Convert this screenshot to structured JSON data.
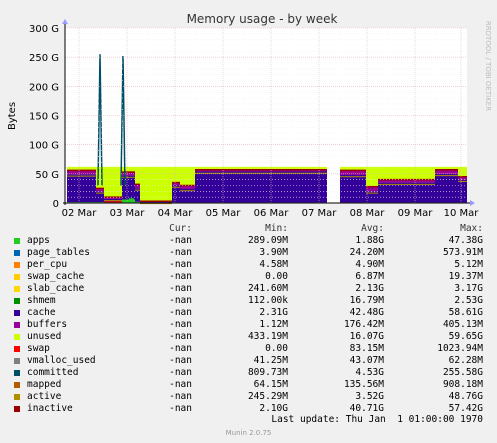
{
  "chart_data": {
    "type": "area",
    "title": "Memory usage - by week",
    "ylabel": "Bytes",
    "watermark": "RRDTOOL / TOBI OETIKER",
    "y_ticks": [
      "0",
      "50 G",
      "100 G",
      "150 G",
      "200 G",
      "250 G",
      "300 G"
    ],
    "ylim_G": [
      0,
      300
    ],
    "x_ticks": [
      "02 Mar",
      "03 Mar",
      "04 Mar",
      "05 Mar",
      "06 Mar",
      "07 Mar",
      "08 Mar",
      "09 Mar",
      "10 Mar"
    ],
    "grid": true,
    "legend_headers": {
      "cur": "Cur:",
      "min": "Min:",
      "avg": "Avg:",
      "max": "Max:"
    },
    "series": [
      {
        "name": "apps",
        "color": "#22cc22",
        "cur": "-nan",
        "min": "289.09M",
        "avg": "1.88G",
        "max": "47.38G"
      },
      {
        "name": "page_tables",
        "color": "#0066b3",
        "cur": "-nan",
        "min": "3.90M",
        "avg": "24.20M",
        "max": "573.91M"
      },
      {
        "name": "per_cpu",
        "color": "#ff8000",
        "cur": "-nan",
        "min": "4.58M",
        "avg": "4.90M",
        "max": "5.12M"
      },
      {
        "name": "swap_cache",
        "color": "#ffcc00",
        "cur": "-nan",
        "min": "0.00",
        "avg": "6.87M",
        "max": "19.37M"
      },
      {
        "name": "slab_cache",
        "color": "#ffd700",
        "cur": "-nan",
        "min": "241.60M",
        "avg": "2.13G",
        "max": "3.17G"
      },
      {
        "name": "shmem",
        "color": "#008f00",
        "cur": "-nan",
        "min": "112.00k",
        "avg": "16.79M",
        "max": "2.53G"
      },
      {
        "name": "cache",
        "color": "#330099",
        "cur": "-nan",
        "min": "2.31G",
        "avg": "42.48G",
        "max": "58.61G"
      },
      {
        "name": "buffers",
        "color": "#990099",
        "cur": "-nan",
        "min": "1.12M",
        "avg": "176.42M",
        "max": "405.13M"
      },
      {
        "name": "unused",
        "color": "#ccff00",
        "cur": "-nan",
        "min": "433.19M",
        "avg": "16.07G",
        "max": "59.65G"
      },
      {
        "name": "swap",
        "color": "#ff0000",
        "cur": "-nan",
        "min": "0.00",
        "avg": "83.15M",
        "max": "1023.94M"
      },
      {
        "name": "vmalloc_used",
        "color": "#808080",
        "cur": "-nan",
        "min": "41.25M",
        "avg": "43.07M",
        "max": "62.28M"
      },
      {
        "name": "committed",
        "color": "#004d66",
        "cur": "-nan",
        "min": "809.73M",
        "avg": "4.53G",
        "max": "255.58G"
      },
      {
        "name": "mapped",
        "color": "#b35a00",
        "cur": "-nan",
        "min": "64.15M",
        "avg": "135.56M",
        "max": "908.18M"
      },
      {
        "name": "active",
        "color": "#b38f00",
        "cur": "-nan",
        "min": "245.29M",
        "avg": "3.52G",
        "max": "48.76G"
      },
      {
        "name": "inactive",
        "color": "#990000",
        "cur": "-nan",
        "min": "2.10G",
        "avg": "40.71G",
        "max": "57.42G"
      }
    ]
  },
  "last_update": "Last update: Thu Jan  1 01:00:00 1970",
  "footer": "Munin 2.0.75"
}
